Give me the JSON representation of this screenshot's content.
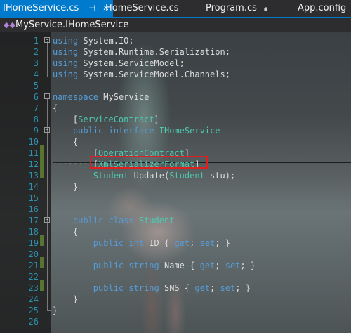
{
  "tabs": [
    {
      "label": "IHomeService.cs",
      "pin": "⊣",
      "close": "✕"
    },
    {
      "label": "HomeService.cs"
    },
    {
      "label": "Program.cs",
      "lock": "🔒︎"
    },
    {
      "label": "App.config"
    }
  ],
  "nav": {
    "icon": "class-icon",
    "label": "MyService.IHomeService"
  },
  "lines": [
    {
      "n": "1",
      "text": "using System.IO;"
    },
    {
      "n": "2",
      "text": "using System.Runtime.Serialization;"
    },
    {
      "n": "3",
      "text": "using System.ServiceModel;"
    },
    {
      "n": "4",
      "text": "using System.ServiceModel.Channels;"
    },
    {
      "n": "5",
      "text": ""
    },
    {
      "n": "6",
      "text": "namespace MyService"
    },
    {
      "n": "7",
      "text": "{"
    },
    {
      "n": "8",
      "text": "    [ServiceContract]"
    },
    {
      "n": "9",
      "text": "    public interface IHomeService"
    },
    {
      "n": "10",
      "text": "    {"
    },
    {
      "n": "11",
      "text": "        [OperationContract]"
    },
    {
      "n": "12",
      "text": "        [XmlSerializerFormat]"
    },
    {
      "n": "13",
      "text": "        Student Update(Student stu);"
    },
    {
      "n": "14",
      "text": "    }"
    },
    {
      "n": "15",
      "text": ""
    },
    {
      "n": "16",
      "text": ""
    },
    {
      "n": "17",
      "text": "    public class Student"
    },
    {
      "n": "18",
      "text": "    {"
    },
    {
      "n": "19",
      "text": "        public int ID { get; set; }"
    },
    {
      "n": "20",
      "text": ""
    },
    {
      "n": "21",
      "text": "        public string Name { get; set; }"
    },
    {
      "n": "22",
      "text": ""
    },
    {
      "n": "23",
      "text": "        public string SNS { get; set; }"
    },
    {
      "n": "24",
      "text": "    }"
    },
    {
      "n": "25",
      "text": "}"
    },
    {
      "n": "26",
      "text": ""
    }
  ],
  "colors": {
    "keyword": "#569cd6",
    "type": "#4ec9b0",
    "line_number": "#2b91af",
    "accent": "#007acc",
    "highlight_box": "#e02020"
  }
}
